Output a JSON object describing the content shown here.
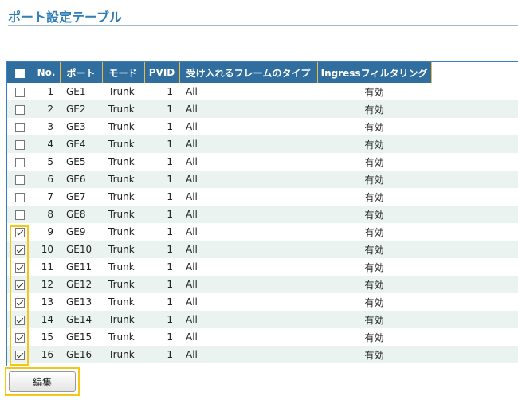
{
  "page": {
    "title": "ポート設定テーブル"
  },
  "table": {
    "columns": {
      "no": "No.",
      "port": "ポート",
      "mode": "モード",
      "pvid": "PVID",
      "accept": "受け入れるフレームのタイプ",
      "ingress": "Ingressフィルタリング"
    },
    "header_checkbox_checked": false,
    "rows": [
      {
        "checked": false,
        "no": "1",
        "port": "GE1",
        "mode": "Trunk",
        "pvid": "1",
        "accept": "All",
        "ingress": "有効"
      },
      {
        "checked": false,
        "no": "2",
        "port": "GE2",
        "mode": "Trunk",
        "pvid": "1",
        "accept": "All",
        "ingress": "有効"
      },
      {
        "checked": false,
        "no": "3",
        "port": "GE3",
        "mode": "Trunk",
        "pvid": "1",
        "accept": "All",
        "ingress": "有効"
      },
      {
        "checked": false,
        "no": "4",
        "port": "GE4",
        "mode": "Trunk",
        "pvid": "1",
        "accept": "All",
        "ingress": "有効"
      },
      {
        "checked": false,
        "no": "5",
        "port": "GE5",
        "mode": "Trunk",
        "pvid": "1",
        "accept": "All",
        "ingress": "有効"
      },
      {
        "checked": false,
        "no": "6",
        "port": "GE6",
        "mode": "Trunk",
        "pvid": "1",
        "accept": "All",
        "ingress": "有効"
      },
      {
        "checked": false,
        "no": "7",
        "port": "GE7",
        "mode": "Trunk",
        "pvid": "1",
        "accept": "All",
        "ingress": "有効"
      },
      {
        "checked": false,
        "no": "8",
        "port": "GE8",
        "mode": "Trunk",
        "pvid": "1",
        "accept": "All",
        "ingress": "有効"
      },
      {
        "checked": true,
        "no": "9",
        "port": "GE9",
        "mode": "Trunk",
        "pvid": "1",
        "accept": "All",
        "ingress": "有効"
      },
      {
        "checked": true,
        "no": "10",
        "port": "GE10",
        "mode": "Trunk",
        "pvid": "1",
        "accept": "All",
        "ingress": "有効"
      },
      {
        "checked": true,
        "no": "11",
        "port": "GE11",
        "mode": "Trunk",
        "pvid": "1",
        "accept": "All",
        "ingress": "有効"
      },
      {
        "checked": true,
        "no": "12",
        "port": "GE12",
        "mode": "Trunk",
        "pvid": "1",
        "accept": "All",
        "ingress": "有効"
      },
      {
        "checked": true,
        "no": "13",
        "port": "GE13",
        "mode": "Trunk",
        "pvid": "1",
        "accept": "All",
        "ingress": "有効"
      },
      {
        "checked": true,
        "no": "14",
        "port": "GE14",
        "mode": "Trunk",
        "pvid": "1",
        "accept": "All",
        "ingress": "有効"
      },
      {
        "checked": true,
        "no": "15",
        "port": "GE15",
        "mode": "Trunk",
        "pvid": "1",
        "accept": "All",
        "ingress": "有効"
      },
      {
        "checked": true,
        "no": "16",
        "port": "GE16",
        "mode": "Trunk",
        "pvid": "1",
        "accept": "All",
        "ingress": "有効"
      }
    ]
  },
  "actions": {
    "edit_label": "編集"
  },
  "colors": {
    "title": "#2f7eb6",
    "header_bg": "#2f6e9e",
    "highlight": "#f5c518",
    "row_alt": "#eaf3ef"
  }
}
